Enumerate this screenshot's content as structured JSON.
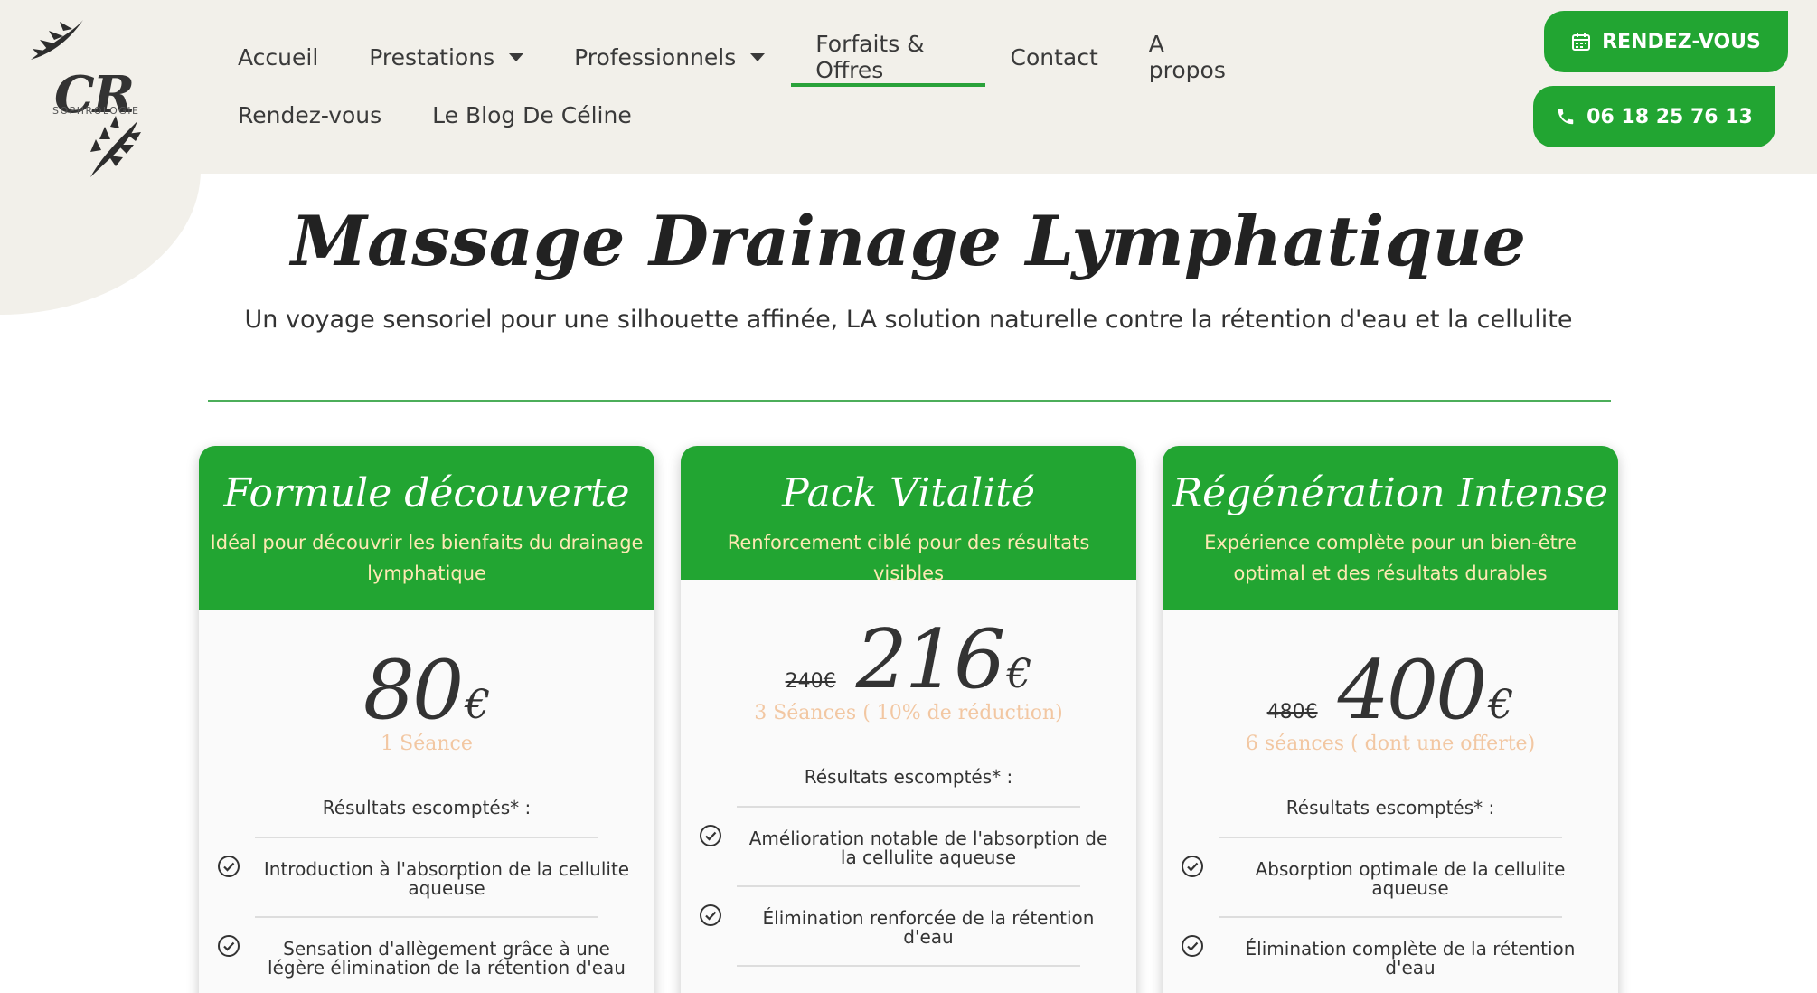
{
  "logo": {
    "text": "CR",
    "subtitle": "SOPHROLOGIE"
  },
  "nav": {
    "row1": [
      {
        "label": "Accueil",
        "dropdown": false,
        "active": false
      },
      {
        "label": "Prestations",
        "dropdown": true,
        "active": false
      },
      {
        "label": "Professionnels",
        "dropdown": true,
        "active": false
      },
      {
        "label": "Forfaits & Offres",
        "dropdown": false,
        "active": true
      },
      {
        "label": "Contact",
        "dropdown": false,
        "active": false
      },
      {
        "label": "A propos",
        "dropdown": false,
        "active": false
      }
    ],
    "row2": [
      {
        "label": "Rendez-vous"
      },
      {
        "label": "Le Blog De Céline"
      }
    ]
  },
  "buttons": {
    "rdv": "RENDEZ-VOUS",
    "phone": "06 18 25 76 13"
  },
  "hero": {
    "title": "Massage Drainage Lymphatique",
    "subtitle": "Un voyage sensoriel pour une silhouette affinée, LA solution naturelle contre la rétention d'eau et la cellulite"
  },
  "cards": [
    {
      "title": "Formule découverte",
      "desc": "Idéal pour découvrir les bienfaits du drainage lymphatique",
      "old_price": "",
      "price": "80",
      "currency": "€",
      "sessions": "1 Séance",
      "results_label": "Résultats escomptés* :",
      "features": [
        "Introduction à l'absorption de la cellulite aqueuse",
        "Sensation d'allègement grâce à une légère élimination de la rétention d'eau"
      ]
    },
    {
      "title": "Pack Vitalité",
      "desc": "Renforcement ciblé pour des résultats visibles",
      "old_price": "240€",
      "price": "216",
      "currency": "€",
      "sessions": "3 Séances ( 10% de réduction)",
      "results_label": "Résultats escomptés* :",
      "features": [
        "Amélioration notable de l'absorption de la cellulite aqueuse",
        "Élimination renforcée de la rétention d'eau"
      ]
    },
    {
      "title": "Régénération Intense",
      "desc": "Expérience complète pour un bien-être optimal et des résultats durables",
      "old_price": "480€",
      "price": "400",
      "currency": "€",
      "sessions": "6 séances ( dont une offerte)",
      "results_label": "Résultats escomptés* :",
      "features": [
        "Absorption optimale de la cellulite aqueuse",
        "Élimination complète de la rétention d'eau"
      ]
    }
  ],
  "colors": {
    "green": "#22a532",
    "header_bg": "#f2f0ea",
    "desc_yellow": "#fde9b3",
    "sessions_peach": "#f2c7a2"
  },
  "icons": {
    "rdv": "calendar-icon",
    "phone": "phone-icon",
    "feature": "check-circle-icon"
  }
}
